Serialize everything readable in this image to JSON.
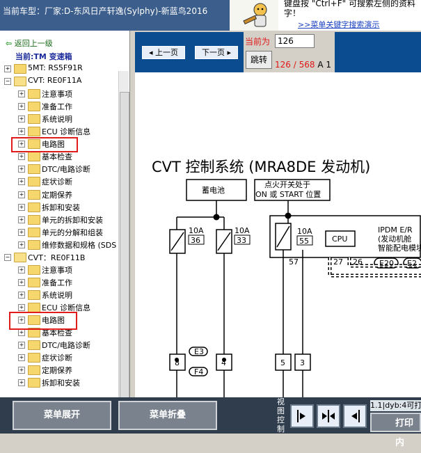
{
  "header": {
    "title": "当前车型：厂家:D-东风日产轩逸(Sylphy)-新蓝鸟2016",
    "promo_line1": "键盘按 \"Ctrl+F\" 可搜索左侧的资料",
    "promo_line2": "字！",
    "promo_link": ">>菜单关键字搜索演示"
  },
  "tree": {
    "back_label": "返回上一级",
    "current_label": "当前:TM 变速箱",
    "nodes": [
      {
        "label": "5MT: RS5F91R",
        "level": 0,
        "expanded": false
      },
      {
        "label": "CVT: RE0F11A",
        "level": 0,
        "expanded": true
      },
      {
        "label": "注意事项",
        "level": 1,
        "expanded": false
      },
      {
        "label": "准备工作",
        "level": 1,
        "expanded": false
      },
      {
        "label": "系统说明",
        "level": 1,
        "expanded": false
      },
      {
        "label": "ECU 诊断信息",
        "level": 1,
        "expanded": false
      },
      {
        "label": "电路图",
        "level": 1,
        "expanded": false
      },
      {
        "label": "基本检查",
        "level": 1,
        "expanded": false
      },
      {
        "label": "DTC/电路诊断",
        "level": 1,
        "expanded": false
      },
      {
        "label": "症状诊断",
        "level": 1,
        "expanded": false
      },
      {
        "label": "定期保养",
        "level": 1,
        "expanded": false
      },
      {
        "label": "拆卸和安装",
        "level": 1,
        "expanded": false
      },
      {
        "label": "单元的拆卸和安装",
        "level": 1,
        "expanded": false
      },
      {
        "label": "单元的分解和组装",
        "level": 1,
        "expanded": false
      },
      {
        "label": "维修数据和规格 (SDS",
        "level": 1,
        "expanded": false
      },
      {
        "label": "CVT：RE0F11B",
        "level": 0,
        "expanded": true
      },
      {
        "label": "注意事项",
        "level": 1,
        "expanded": false
      },
      {
        "label": "准备工作",
        "level": 1,
        "expanded": false
      },
      {
        "label": "系统说明",
        "level": 1,
        "expanded": false
      },
      {
        "label": "ECU 诊断信息",
        "level": 1,
        "expanded": false
      },
      {
        "label": "电路图",
        "level": 1,
        "expanded": false
      },
      {
        "label": "基本检查",
        "level": 1,
        "expanded": false
      },
      {
        "label": "DTC/电路诊断",
        "level": 1,
        "expanded": false
      },
      {
        "label": "症状诊断",
        "level": 1,
        "expanded": false
      },
      {
        "label": "定期保养",
        "level": 1,
        "expanded": false
      },
      {
        "label": "拆卸和安装",
        "level": 1,
        "expanded": false
      }
    ]
  },
  "viewer": {
    "prev_label": "上一页",
    "next_label": "下一页",
    "current_page_label": "当前为",
    "page_input_value": "126",
    "jump_label": "跳转",
    "page_current": "126",
    "page_total": "568",
    "page_suffix": "A 1"
  },
  "diagram": {
    "title": "CVT 控制系统 (MRA8DE 发动机)",
    "battery": "蓄电池",
    "ignition_line1": "点火开关处于",
    "ignition_line2": "ON 或 START 位置",
    "fuse1_amp": "10A",
    "fuse1_num": "36",
    "fuse2_amp": "10A",
    "fuse2_num": "33",
    "fuse3_amp": "10A",
    "fuse3_num": "55",
    "cpu_label": "CPU",
    "ipdm_line1": "IPDM E/R",
    "ipdm_line2": "(发动机舱",
    "ipdm_line3": "智能配电模块",
    "pin57": "57",
    "pin27": "27",
    "pin26": "26",
    "conn_e20": "E20",
    "conn_e2": "E2",
    "conn_e3": "E3",
    "conn_f4": "F4",
    "term8": "8",
    "term4": "4",
    "term5": "5",
    "term3": "3"
  },
  "footer": {
    "expand_label": "菜单展开",
    "collapse_label": "菜单折叠",
    "view_control_label": "视图控制",
    "info_text": "1.1|dyb:4可打",
    "print_label": "打印内"
  }
}
